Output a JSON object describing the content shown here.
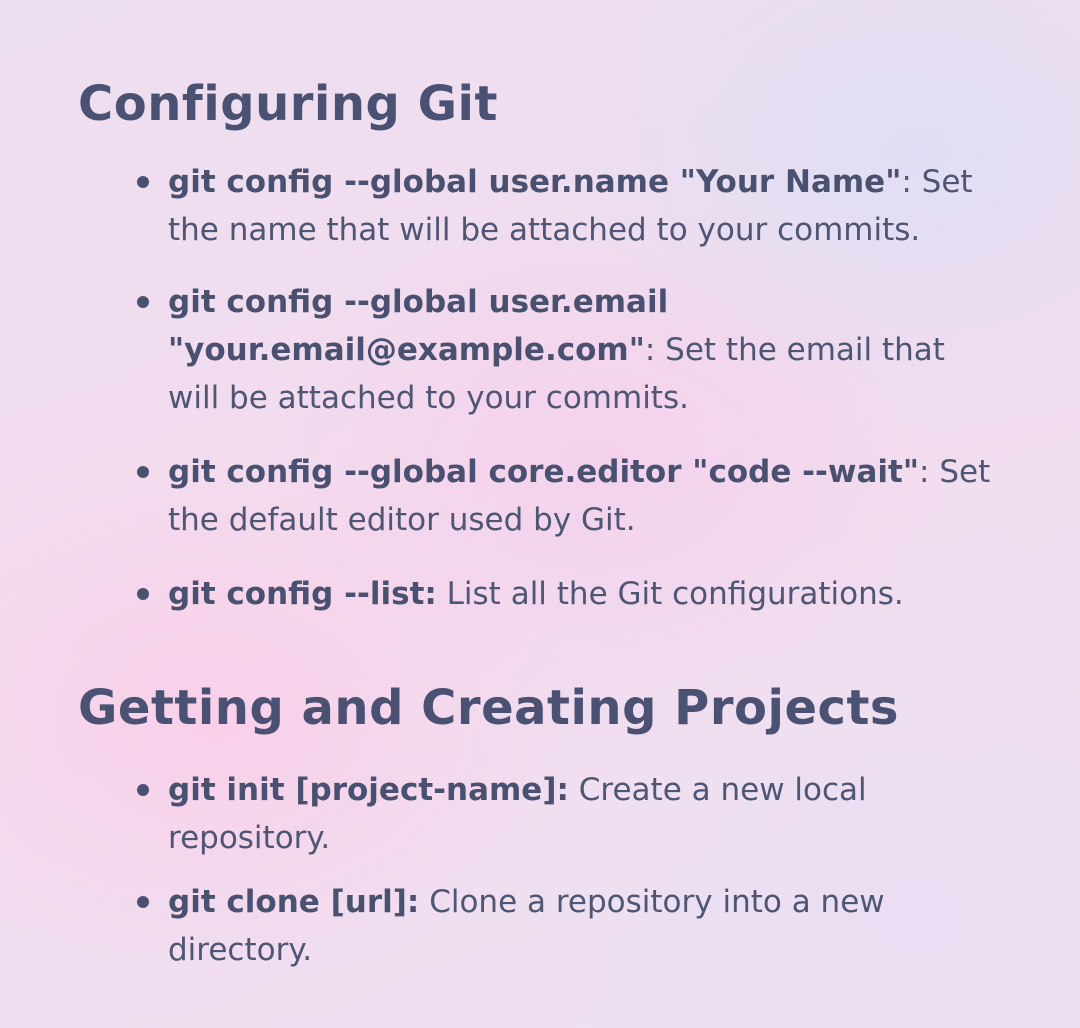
{
  "sections": [
    {
      "title": "Configuring Git",
      "items": [
        {
          "command": " git config --global user.name \"Your Name\"",
          "description": ": Set the name that will be attached to your commits."
        },
        {
          "command": "git config --global user.email \"your.email@example.com\"",
          "description": ": Set the email that will be attached to your commits."
        },
        {
          "command": "git config --global core.editor \"code --wait\"",
          "description": ": Set the default editor used by Git."
        },
        {
          "command": "git config --list:",
          "description": " List all the Git configurations."
        }
      ]
    },
    {
      "title": "Getting and Creating Projects",
      "items": [
        {
          "command": "git init [project-name]:",
          "description": " Create a new local repository."
        },
        {
          "command": "git clone [url]:",
          "description": " Clone a repository into a new directory."
        }
      ]
    }
  ]
}
